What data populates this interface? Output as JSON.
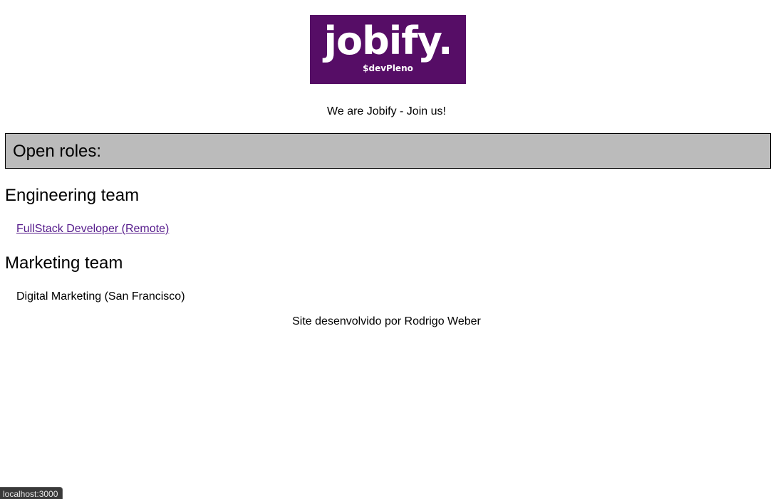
{
  "logo": {
    "wordmark": "jobify.",
    "subtitle": "$devPleno",
    "background_color": "#560d66"
  },
  "tagline": "We are Jobify - Join us!",
  "roles_section": {
    "title": "Open roles:",
    "background_color": "#bbbbbb"
  },
  "teams": [
    {
      "name": "Engineering team",
      "roles": [
        {
          "label": "FullStack Developer (Remote)",
          "is_link": true
        }
      ]
    },
    {
      "name": "Marketing team",
      "roles": [
        {
          "label": "Digital Marketing (San Francisco)",
          "is_link": false
        }
      ]
    }
  ],
  "footer": "Site desenvolvido por Rodrigo Weber",
  "status_bar": {
    "hover_url": "localhost:3000"
  },
  "colors": {
    "link": "#551a8b"
  }
}
